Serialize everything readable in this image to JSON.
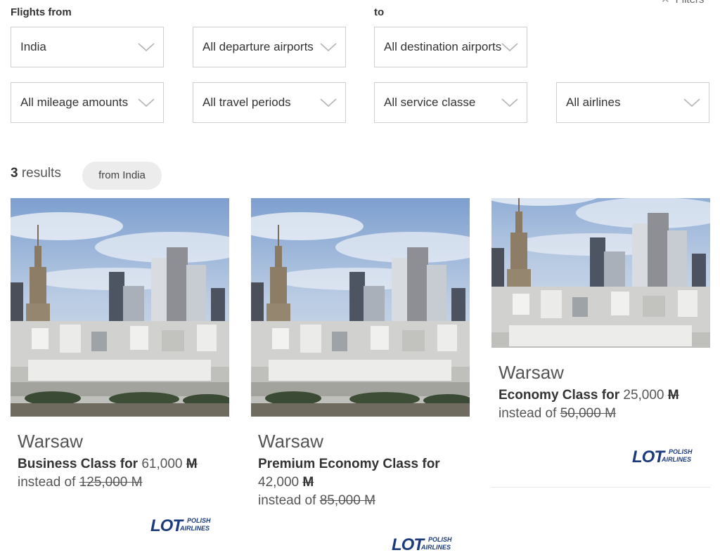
{
  "filters": {
    "from_label": "Flights from",
    "to_label": "to",
    "filters_link": "Filters",
    "country": "India",
    "departure": "All departure airports",
    "destination": "All destination airports",
    "mileage": "All mileage amounts",
    "period": "All travel periods",
    "service": "All service classe",
    "airlines": "All airlines"
  },
  "results": {
    "count": "3",
    "label": "results",
    "chip": "from India"
  },
  "cards": [
    {
      "city": "Warsaw",
      "class_label": "Business Class for",
      "price": "61,000",
      "instead_label": "instead of",
      "old_price": "125,000",
      "miles_symbol": "M",
      "airline_logo": "LOT",
      "airline_tag_1": "POLISH",
      "airline_tag_2": "AIRLINES"
    },
    {
      "city": "Warsaw",
      "class_label": "Premium Economy Class for",
      "price": "42,000",
      "instead_label": "instead of",
      "old_price": "85,000",
      "miles_symbol": "M",
      "airline_logo": "LOT",
      "airline_tag_1": "POLISH",
      "airline_tag_2": "AIRLINES"
    },
    {
      "city": "Warsaw",
      "class_label": "Economy Class for",
      "price": "25,000",
      "instead_label": "instead of",
      "old_price": "50,000",
      "miles_symbol": "M",
      "airline_logo": "LOT",
      "airline_tag_1": "POLISH",
      "airline_tag_2": "AIRLINES"
    }
  ],
  "icons": {
    "chevron": "chevron-down-icon",
    "close": "close-icon"
  },
  "colors": {
    "lot_blue": "#1c3b7d",
    "border": "#cfcfcf",
    "chip_bg": "#ececec"
  }
}
